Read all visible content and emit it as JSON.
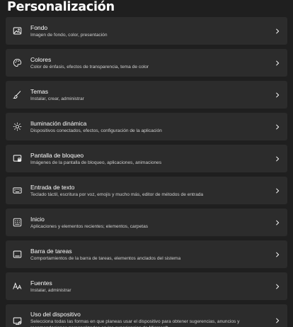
{
  "page": {
    "title": "Personalización"
  },
  "items": [
    {
      "label": "Fondo",
      "desc": "Imagen de fondo, color, presentación",
      "icon": "image-icon"
    },
    {
      "label": "Colores",
      "desc": "Color de énfasis, efectos de transparencia, tema de color",
      "icon": "palette-icon"
    },
    {
      "label": "Temas",
      "desc": "Instalar, crear, administrar",
      "icon": "brush-icon"
    },
    {
      "label": "Iluminación dinámica",
      "desc": "Dispositivos conectados, efectos, configuración de la aplicación",
      "icon": "lighting-icon"
    },
    {
      "label": "Pantalla de bloqueo",
      "desc": "Imágenes de la pantalla de bloqueo, aplicaciones, animaciones",
      "icon": "lock-screen-icon"
    },
    {
      "label": "Entrada de texto",
      "desc": "Teclado táctil, escritura por voz, emojis y mucho más, editor de métodos de entrada",
      "icon": "keyboard-icon"
    },
    {
      "label": "Inicio",
      "desc": "Aplicaciones y elementos recientes; elementos, carpetas",
      "icon": "start-icon"
    },
    {
      "label": "Barra de tareas",
      "desc": "Comportamientos de la barra de tareas, elementos anclados del sistema",
      "icon": "taskbar-icon"
    },
    {
      "label": "Fuentes",
      "desc": "Instalar, administrar",
      "icon": "fonts-icon"
    },
    {
      "label": "Uso del dispositivo",
      "desc": "Selecciona todas las formas en que planeas usar el dispositivo para obtener sugerencias, anuncios y recomendaciones personalizados en las experiencias de Microsoft.",
      "icon": "device-usage-icon"
    }
  ]
}
